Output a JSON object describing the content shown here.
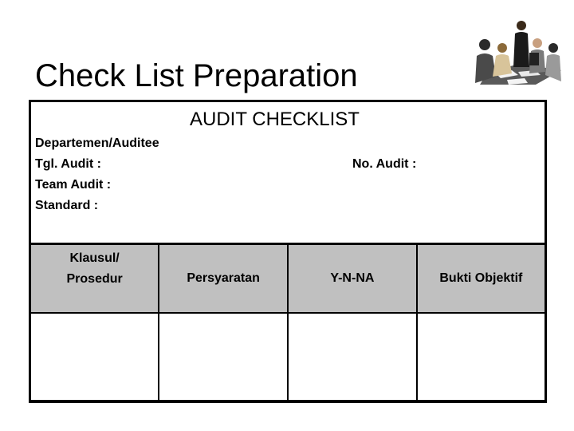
{
  "slide": {
    "title": "Check List Preparation",
    "clipart_icon": "business-meeting-clipart"
  },
  "form": {
    "heading": "AUDIT CHECKLIST",
    "fields": {
      "department": "Departemen/Auditee",
      "audit_date": "Tgl. Audit :",
      "audit_team": "Team Audit :",
      "standard": "Standard :",
      "audit_number": "No. Audit :"
    }
  },
  "table": {
    "headers": [
      {
        "line1": "Klausul/",
        "line2": "Prosedur"
      },
      {
        "line1": "Persyaratan"
      },
      {
        "line1": "Y-N-NA"
      },
      {
        "line1": "Bukti Objektif"
      }
    ],
    "rows": [
      [
        "",
        "",
        "",
        ""
      ]
    ]
  },
  "colors": {
    "header_fill": "#c0c0c0",
    "border": "#000000",
    "background": "#ffffff"
  }
}
